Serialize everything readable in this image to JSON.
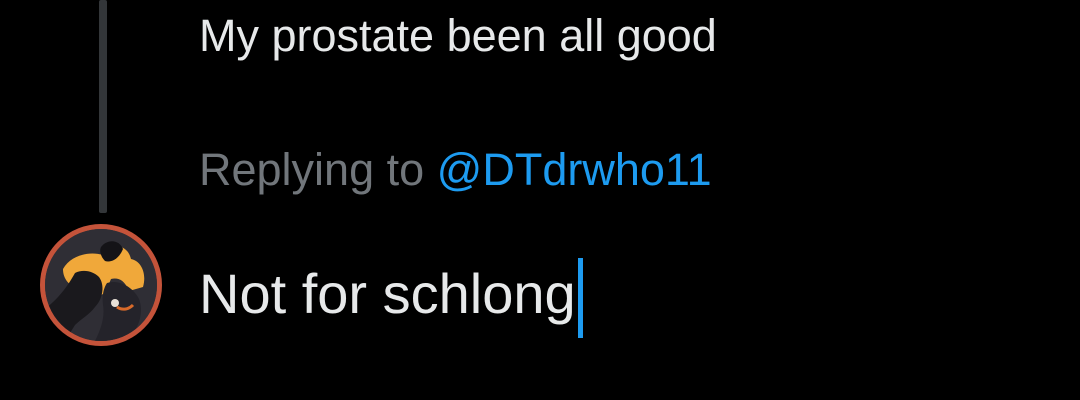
{
  "parent_tweet": {
    "text": "My prostate been all good"
  },
  "reply_context": {
    "prefix": "Replying to",
    "handle": "@DTdrwho11"
  },
  "composer": {
    "text": "Not for schlong",
    "avatar_icon": "user-avatar"
  },
  "colors": {
    "background": "#000000",
    "text_primary": "#e7e9ea",
    "text_secondary": "#71767b",
    "accent": "#1d9bf0",
    "thread_line": "#333639",
    "avatar_ring": "#c4533a"
  }
}
